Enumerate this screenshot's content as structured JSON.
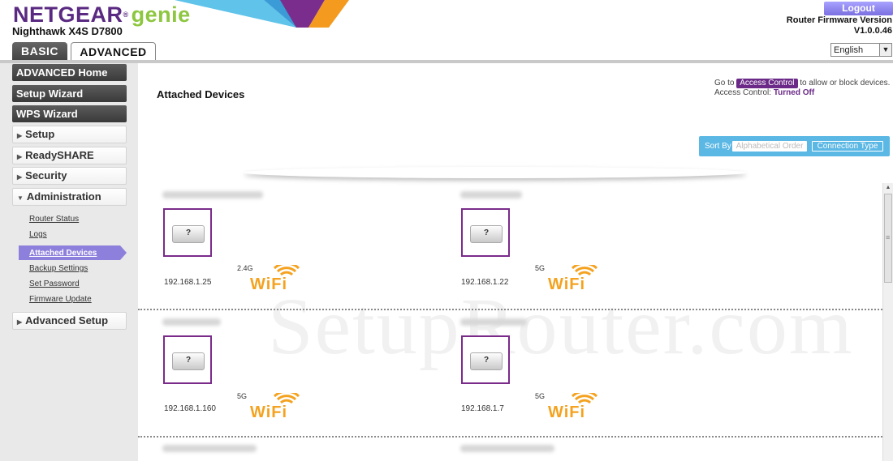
{
  "brand": {
    "name": "NETGEAR",
    "reg": "®",
    "sub": "genie",
    "model": "Nighthawk X4S D7800"
  },
  "header": {
    "logout_label": "Logout",
    "firmware_label": "Router Firmware Version",
    "firmware_version": "V1.0.0.46",
    "language": "English"
  },
  "tabs": [
    {
      "label": "BASIC",
      "active": false
    },
    {
      "label": "ADVANCED",
      "active": true
    }
  ],
  "sidebar": {
    "primary": [
      "ADVANCED Home",
      "Setup Wizard",
      "WPS Wizard"
    ],
    "sections": [
      "Setup",
      "ReadySHARE",
      "Security",
      "Administration"
    ],
    "admin_items": [
      "Router Status",
      "Logs",
      "Attached Devices",
      "Backup Settings",
      "Set Password",
      "Firmware Update"
    ],
    "active_item": "Attached Devices",
    "last_section": "Advanced Setup"
  },
  "main": {
    "title": "Attached Devices",
    "access": {
      "goto": "Go to",
      "button": "Access Control",
      "suffix": "to allow or block devices.",
      "status_label": "Access Control:",
      "status_value": "Turned Off"
    },
    "sort": {
      "label": "Sort By",
      "option_alpha": "Alphabetical Order",
      "option_conn": "Connection Type"
    }
  },
  "devices": [
    {
      "ip": "192.168.1.25",
      "band": "2.4G",
      "icon_text": "?",
      "wifi": "WiFi"
    },
    {
      "ip": "192.168.1.22",
      "band": "5G",
      "icon_text": "?",
      "wifi": "WiFi"
    },
    {
      "ip": "192.168.1.160",
      "band": "5G",
      "icon_text": "?",
      "wifi": "WiFi"
    },
    {
      "ip": "192.168.1.7",
      "band": "5G",
      "icon_text": "?",
      "wifi": "WiFi"
    }
  ],
  "watermark": "SetupRouter.com",
  "colors": {
    "purple": "#6b2a88",
    "genie_green": "#8dc63f",
    "wifi_orange": "#f4a21f",
    "sort_blue": "#5bb7e4",
    "active_nav": "#8d7fdc"
  }
}
